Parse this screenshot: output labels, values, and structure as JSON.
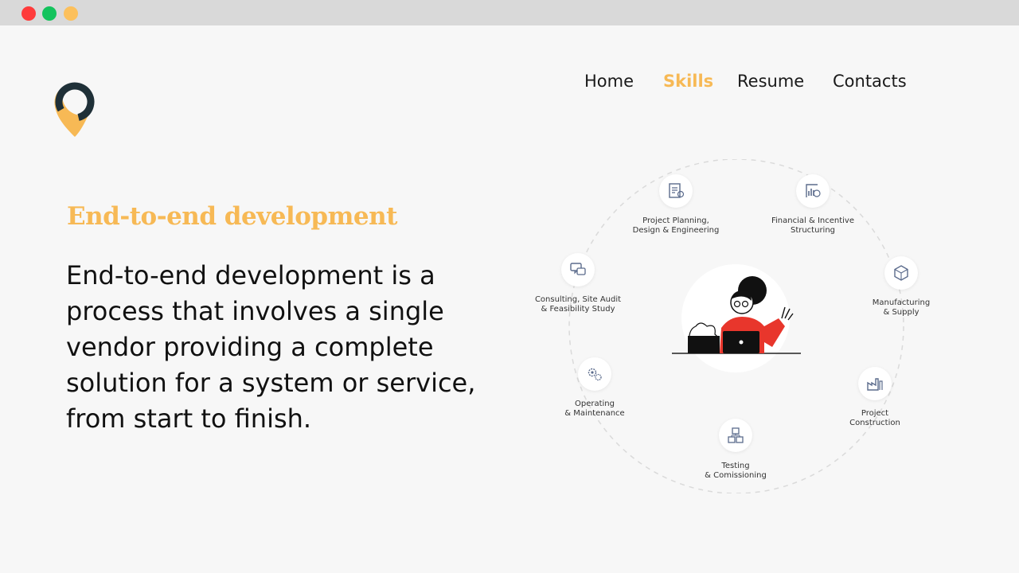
{
  "window": {
    "controls": [
      {
        "name": "close",
        "color": "#ff3b3b"
      },
      {
        "name": "maximize",
        "color": "#14c35d"
      },
      {
        "name": "minimize",
        "color": "#fcc05c"
      }
    ]
  },
  "colors": {
    "accent": "#f7b955",
    "logo_dark": "#1f3038",
    "text": "#111111"
  },
  "logo": {
    "icon": "location-pin-logo"
  },
  "nav": {
    "items": [
      {
        "label": "Home",
        "active": false
      },
      {
        "label": "Skills",
        "active": true
      },
      {
        "label": "Resume",
        "active": false
      },
      {
        "label": "Contacts",
        "active": false
      }
    ]
  },
  "hero": {
    "heading": "End-to-end development",
    "body": "End-to-end development is a process that involves a single vendor providing a complete solution for a system or service, from start to finish."
  },
  "diagram": {
    "nodes": [
      {
        "line1": "Project Planning,",
        "line2": "Design & Engineering",
        "icon": "blueprint-icon"
      },
      {
        "line1": "Financial & Incentive",
        "line2": "Structuring",
        "icon": "finance-chart-icon"
      },
      {
        "line1": "Manufacturing",
        "line2": "& Supply",
        "icon": "cube-network-icon"
      },
      {
        "line1": "Project",
        "line2": "Construction",
        "icon": "factory-icon"
      },
      {
        "line1": "Testing",
        "line2": "& Comissioning",
        "icon": "boxes-icon"
      },
      {
        "line1": "Operating",
        "line2": "& Maintenance",
        "icon": "gears-icon"
      },
      {
        "line1": "Consulting, Site Audit",
        "line2": "& Feasibility Study",
        "icon": "chat-icon"
      }
    ],
    "center_icon": "person-with-laptop-illustration"
  }
}
